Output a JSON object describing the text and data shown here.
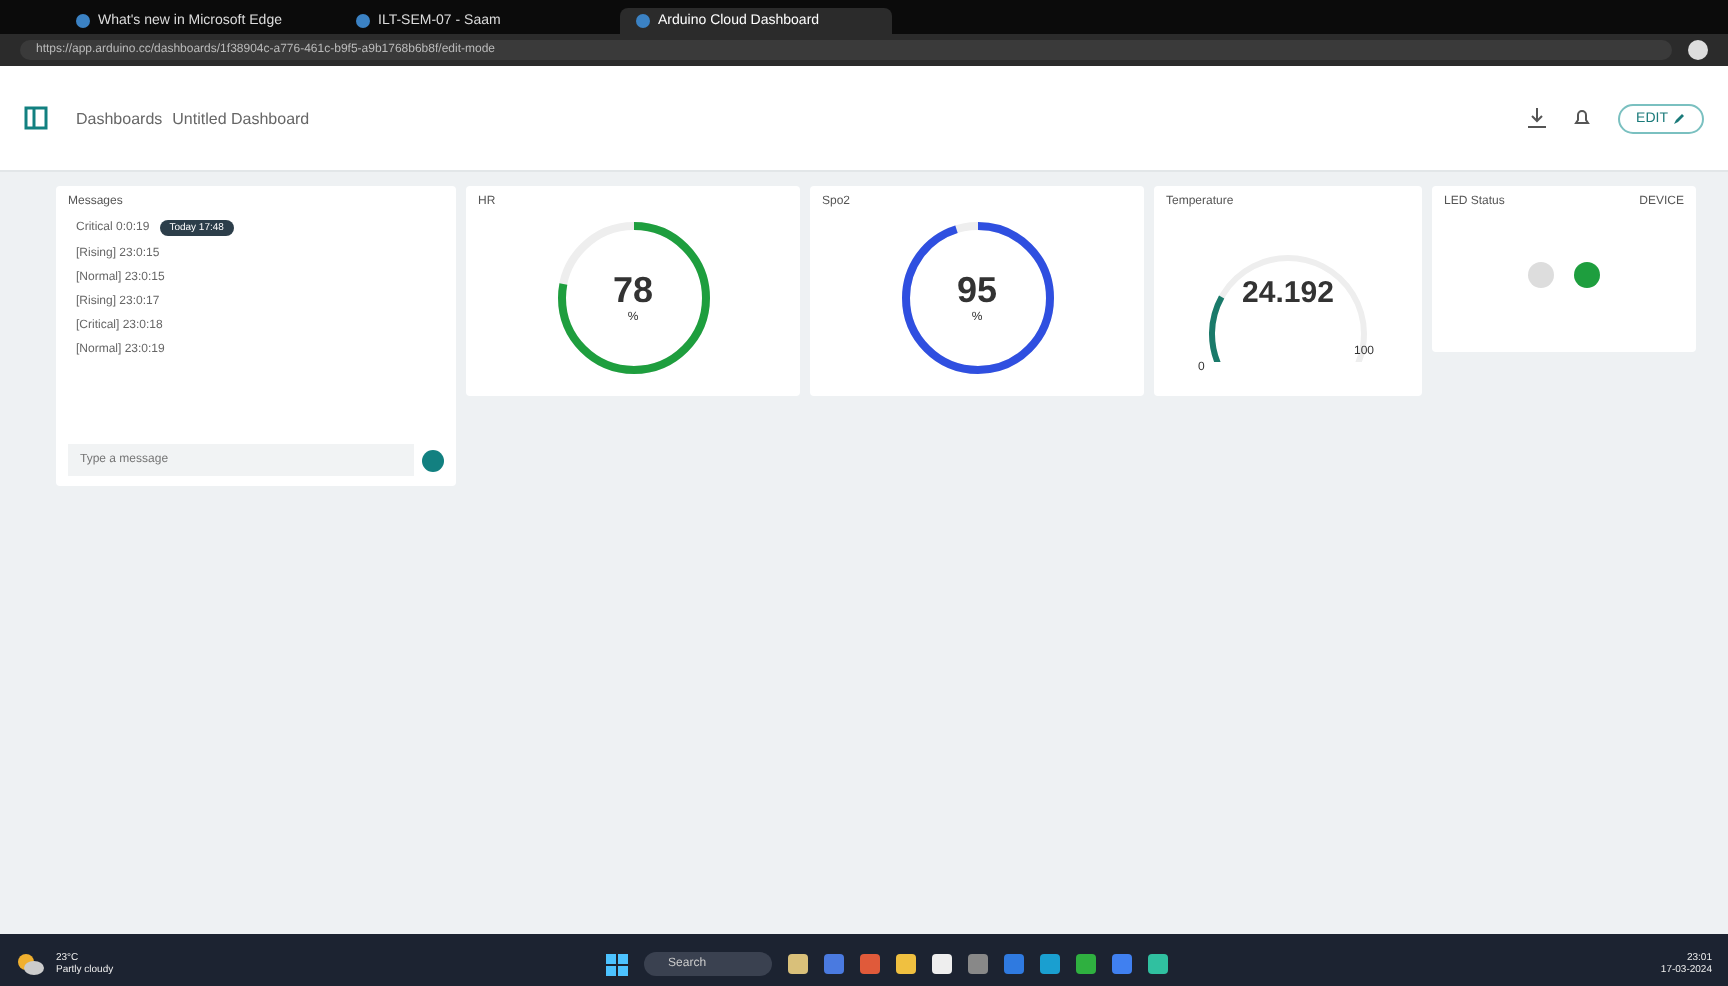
{
  "browser": {
    "tabs": [
      {
        "title": "What's new in Microsoft Edge",
        "selected": false
      },
      {
        "title": "ILT-SEM-07 - Saam",
        "selected": false
      },
      {
        "title": "Arduino Cloud Dashboard",
        "selected": true
      }
    ],
    "address": "https://app.arduino.cc/dashboards/1f38904c-a776-461c-b9f5-a9b1768b6b8f/edit-mode"
  },
  "header": {
    "breadcrumb": "Dashboards",
    "dashboard": "Untitled Dashboard",
    "edit_label": "EDIT"
  },
  "messages": {
    "title": "Messages",
    "badge": "Today 17:48",
    "first": "Critical 0:0:19",
    "items": [
      "[Rising] 23:0:15",
      "[Normal] 23:0:15",
      "[Rising] 23:0:17",
      "[Critical] 23:0:18",
      "[Normal] 23:0:19"
    ],
    "placeholder": "Type a message"
  },
  "gauges": [
    {
      "kind": "ring",
      "title": "HR",
      "value": "78",
      "unit": "%",
      "level": 0.78,
      "color": "#1e9e3e"
    },
    {
      "kind": "ring",
      "title": "Spo2",
      "value": "95",
      "unit": "%",
      "level": 0.95,
      "color": "#2f4fe0"
    },
    {
      "kind": "arc",
      "title": "Temperature",
      "value": "24.192",
      "min": "0",
      "max": "100",
      "color": "#1a7a6a"
    }
  ],
  "led": {
    "title": "LED Status",
    "tag": "DEVICE",
    "on": true
  },
  "taskbar": {
    "weather_temp": "23°C",
    "weather_text": "Partly cloudy",
    "search": "Search",
    "time": "23:01",
    "date": "17-03-2024"
  }
}
